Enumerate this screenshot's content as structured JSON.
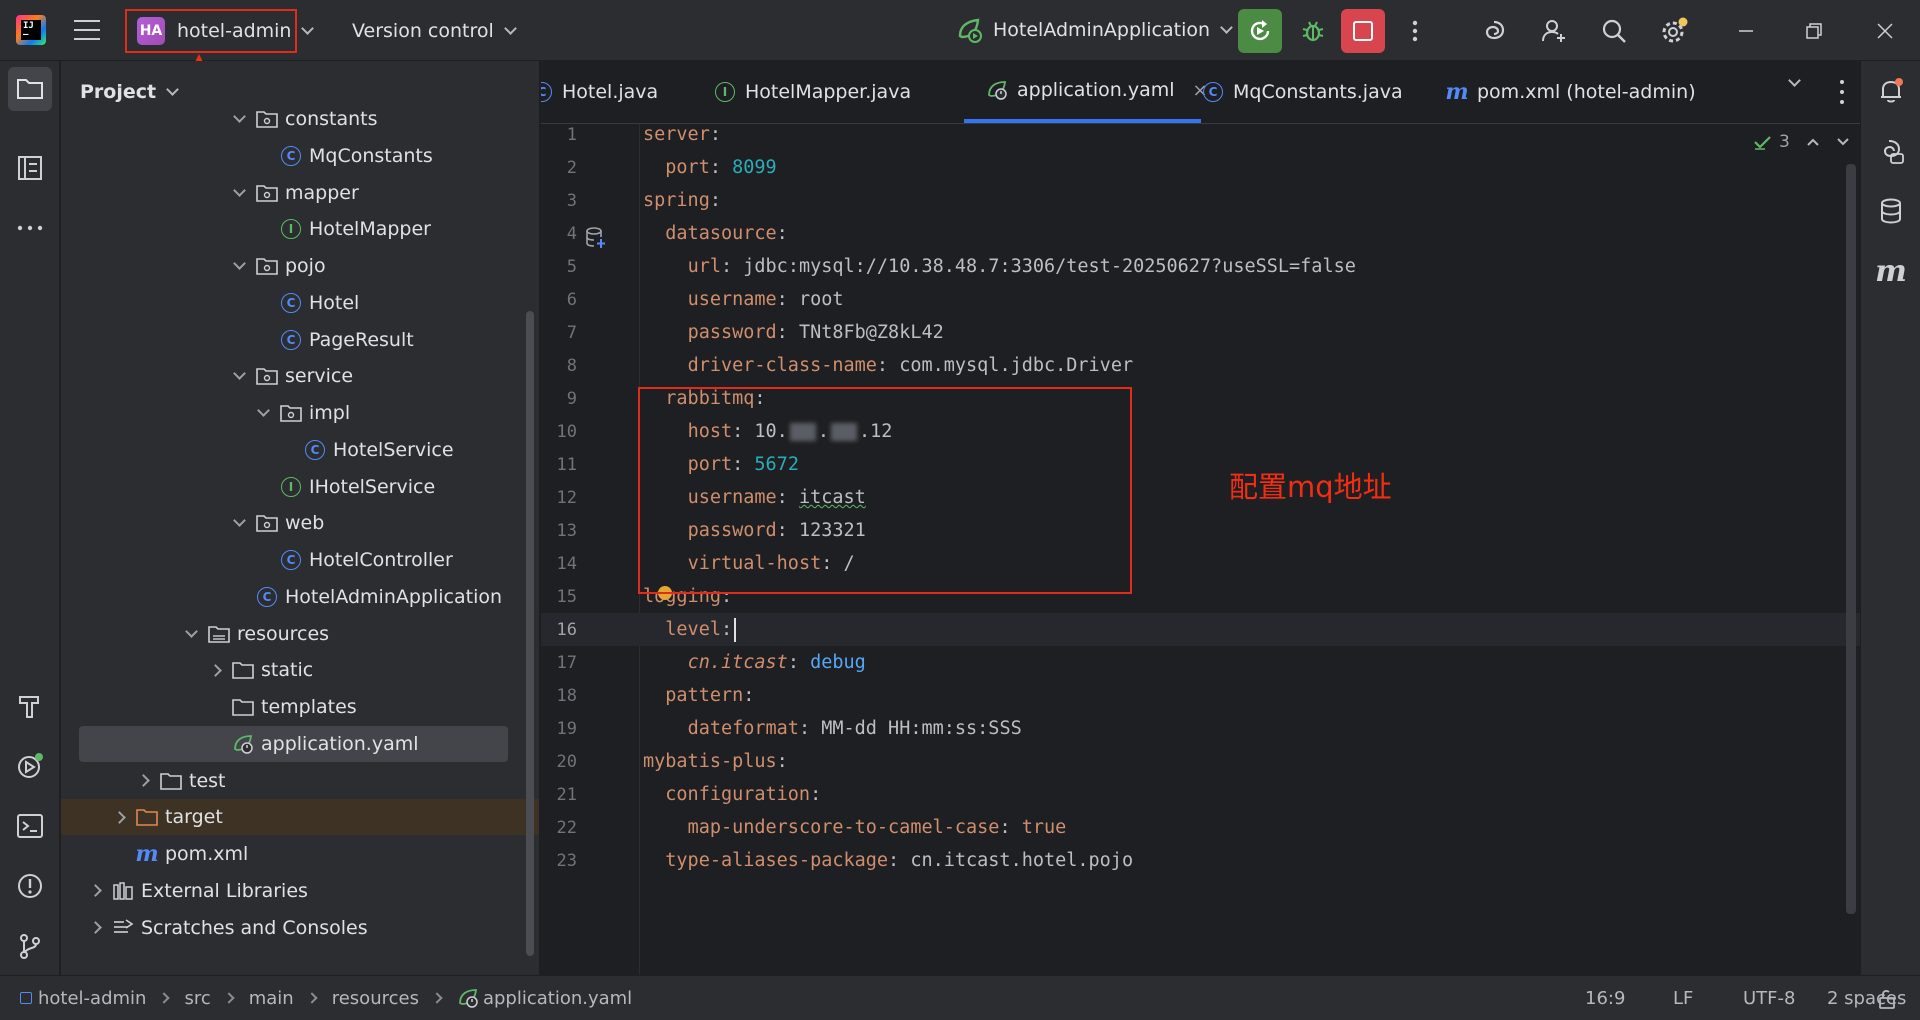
{
  "titlebar": {
    "project_badge": "HA",
    "project_name": "hotel-admin",
    "vcs_label": "Version control",
    "run_config": "HotelAdminApplication"
  },
  "project_panel": {
    "title": "Project",
    "tree": [
      {
        "label": "constants",
        "kind": "package",
        "depth": 6,
        "expanded": true
      },
      {
        "label": "MqConstants",
        "kind": "class",
        "depth": 7
      },
      {
        "label": "mapper",
        "kind": "package",
        "depth": 6,
        "expanded": true
      },
      {
        "label": "HotelMapper",
        "kind": "interface",
        "depth": 7
      },
      {
        "label": "pojo",
        "kind": "package",
        "depth": 6,
        "expanded": true
      },
      {
        "label": "Hotel",
        "kind": "class",
        "depth": 7
      },
      {
        "label": "PageResult",
        "kind": "class",
        "depth": 7
      },
      {
        "label": "service",
        "kind": "package",
        "depth": 6,
        "expanded": true
      },
      {
        "label": "impl",
        "kind": "package",
        "depth": 7,
        "expanded": true
      },
      {
        "label": "HotelService",
        "kind": "class",
        "depth": 8
      },
      {
        "label": "IHotelService",
        "kind": "interface",
        "depth": 7
      },
      {
        "label": "web",
        "kind": "package",
        "depth": 6,
        "expanded": true
      },
      {
        "label": "HotelController",
        "kind": "class",
        "depth": 7
      },
      {
        "label": "HotelAdminApplication",
        "kind": "springclass",
        "depth": 6
      },
      {
        "label": "resources",
        "kind": "resources",
        "depth": 4,
        "expanded": true
      },
      {
        "label": "static",
        "kind": "folder",
        "depth": 5,
        "expanded": false
      },
      {
        "label": "templates",
        "kind": "folder",
        "depth": 5,
        "noarrow": true
      },
      {
        "label": "application.yaml",
        "kind": "yaml",
        "depth": 5,
        "noarrow": true,
        "selected": true
      },
      {
        "label": "test",
        "kind": "folder",
        "depth": 3,
        "expanded": false
      },
      {
        "label": "target",
        "kind": "targetfolder",
        "depth": 2,
        "expanded": false,
        "highlight": true
      },
      {
        "label": "pom.xml",
        "kind": "maven",
        "depth": 2,
        "noarrow": true
      },
      {
        "label": "External Libraries",
        "kind": "libraries",
        "depth": 1,
        "expanded": false
      },
      {
        "label": "Scratches and Consoles",
        "kind": "scratches",
        "depth": 1,
        "expanded": false
      }
    ]
  },
  "tabs": [
    {
      "label": "Hotel.java",
      "icon": "class"
    },
    {
      "label": "HotelMapper.java",
      "icon": "interface"
    },
    {
      "label": "application.yaml",
      "icon": "yaml",
      "active": true,
      "close": "×"
    },
    {
      "label": "MqConstants.java",
      "icon": "class"
    },
    {
      "label": "pom.xml (hotel-admin)",
      "icon": "maven"
    }
  ],
  "editor": {
    "inspection_count": "3",
    "current_line": 16,
    "annotation": "配置mq地址",
    "lines": [
      {
        "n": "1",
        "indent": "",
        "key": "server",
        "sep": ":",
        "value": "",
        "vtype": ""
      },
      {
        "n": "2",
        "indent": "  ",
        "key": "port",
        "sep": ": ",
        "value": "8099",
        "vtype": "num"
      },
      {
        "n": "3",
        "indent": "",
        "key": "spring",
        "sep": ":",
        "value": "",
        "vtype": ""
      },
      {
        "n": "4",
        "indent": "  ",
        "key": "datasource",
        "sep": ":",
        "value": "",
        "vtype": ""
      },
      {
        "n": "5",
        "indent": "    ",
        "key": "url",
        "sep": ": ",
        "value": "jdbc:mysql://10.38.48.7:3306/test-20250627?useSSL=false",
        "vtype": "val"
      },
      {
        "n": "6",
        "indent": "    ",
        "key": "username",
        "sep": ": ",
        "value": "root",
        "vtype": "val"
      },
      {
        "n": "7",
        "indent": "    ",
        "key": "password",
        "sep": ": ",
        "value": "TNt8Fb@Z8kL42",
        "vtype": "val"
      },
      {
        "n": "8",
        "indent": "    ",
        "key": "driver-class-name",
        "sep": ": ",
        "value": "com.mysql.jdbc.Driver",
        "vtype": "val"
      },
      {
        "n": "9",
        "indent": "  ",
        "key": "rabbitmq",
        "sep": ":",
        "value": "",
        "vtype": ""
      },
      {
        "n": "10",
        "indent": "    ",
        "key": "host",
        "sep": ": ",
        "value": "10.",
        "value_tail": ".12",
        "vtype": "blurred"
      },
      {
        "n": "11",
        "indent": "    ",
        "key": "port",
        "sep": ": ",
        "value": "5672",
        "vtype": "num"
      },
      {
        "n": "12",
        "indent": "    ",
        "key": "username",
        "sep": ": ",
        "value": "itcast",
        "vtype": "squig"
      },
      {
        "n": "13",
        "indent": "    ",
        "key": "password",
        "sep": ": ",
        "value": "123321",
        "vtype": "val"
      },
      {
        "n": "14",
        "indent": "    ",
        "key": "virtual-host",
        "sep": ": ",
        "value": "/",
        "vtype": "val"
      },
      {
        "n": "15",
        "indent": "",
        "key": "logging",
        "sep": ":",
        "value": "",
        "vtype": ""
      },
      {
        "n": "16",
        "indent": "  ",
        "key": "level",
        "sep": ":",
        "value": "",
        "vtype": "caret"
      },
      {
        "n": "17",
        "indent": "    ",
        "key": "cn.itcast",
        "sep": ": ",
        "value": "debug",
        "vtype": "italkey"
      },
      {
        "n": "18",
        "indent": "  ",
        "key": "pattern",
        "sep": ":",
        "value": "",
        "vtype": ""
      },
      {
        "n": "19",
        "indent": "    ",
        "key": "dateformat",
        "sep": ": ",
        "value": "MM-dd HH:mm:ss:SSS",
        "vtype": "val"
      },
      {
        "n": "20",
        "indent": "",
        "key": "mybatis-plus",
        "sep": ":",
        "value": "",
        "vtype": ""
      },
      {
        "n": "21",
        "indent": "  ",
        "key": "configuration",
        "sep": ":",
        "value": "",
        "vtype": ""
      },
      {
        "n": "22",
        "indent": "    ",
        "key": "map-underscore-to-camel-case",
        "sep": ": ",
        "value": "true",
        "vtype": "kwd"
      },
      {
        "n": "23",
        "indent": "  ",
        "key": "type-aliases-package",
        "sep": ": ",
        "value": "cn.itcast.hotel.pojo",
        "vtype": "pkg"
      }
    ]
  },
  "statusbar": {
    "breadcrumbs": [
      "hotel-admin",
      "src",
      "main",
      "resources",
      "application.yaml"
    ],
    "position": "16:9",
    "line_sep": "LF",
    "encoding": "UTF-8",
    "indent": "2 spaces"
  },
  "colors": {
    "accent": "#3574f0",
    "run_green": "#4c8b44",
    "stop_red": "#d9454f",
    "annotation_red": "#e02d1b"
  }
}
